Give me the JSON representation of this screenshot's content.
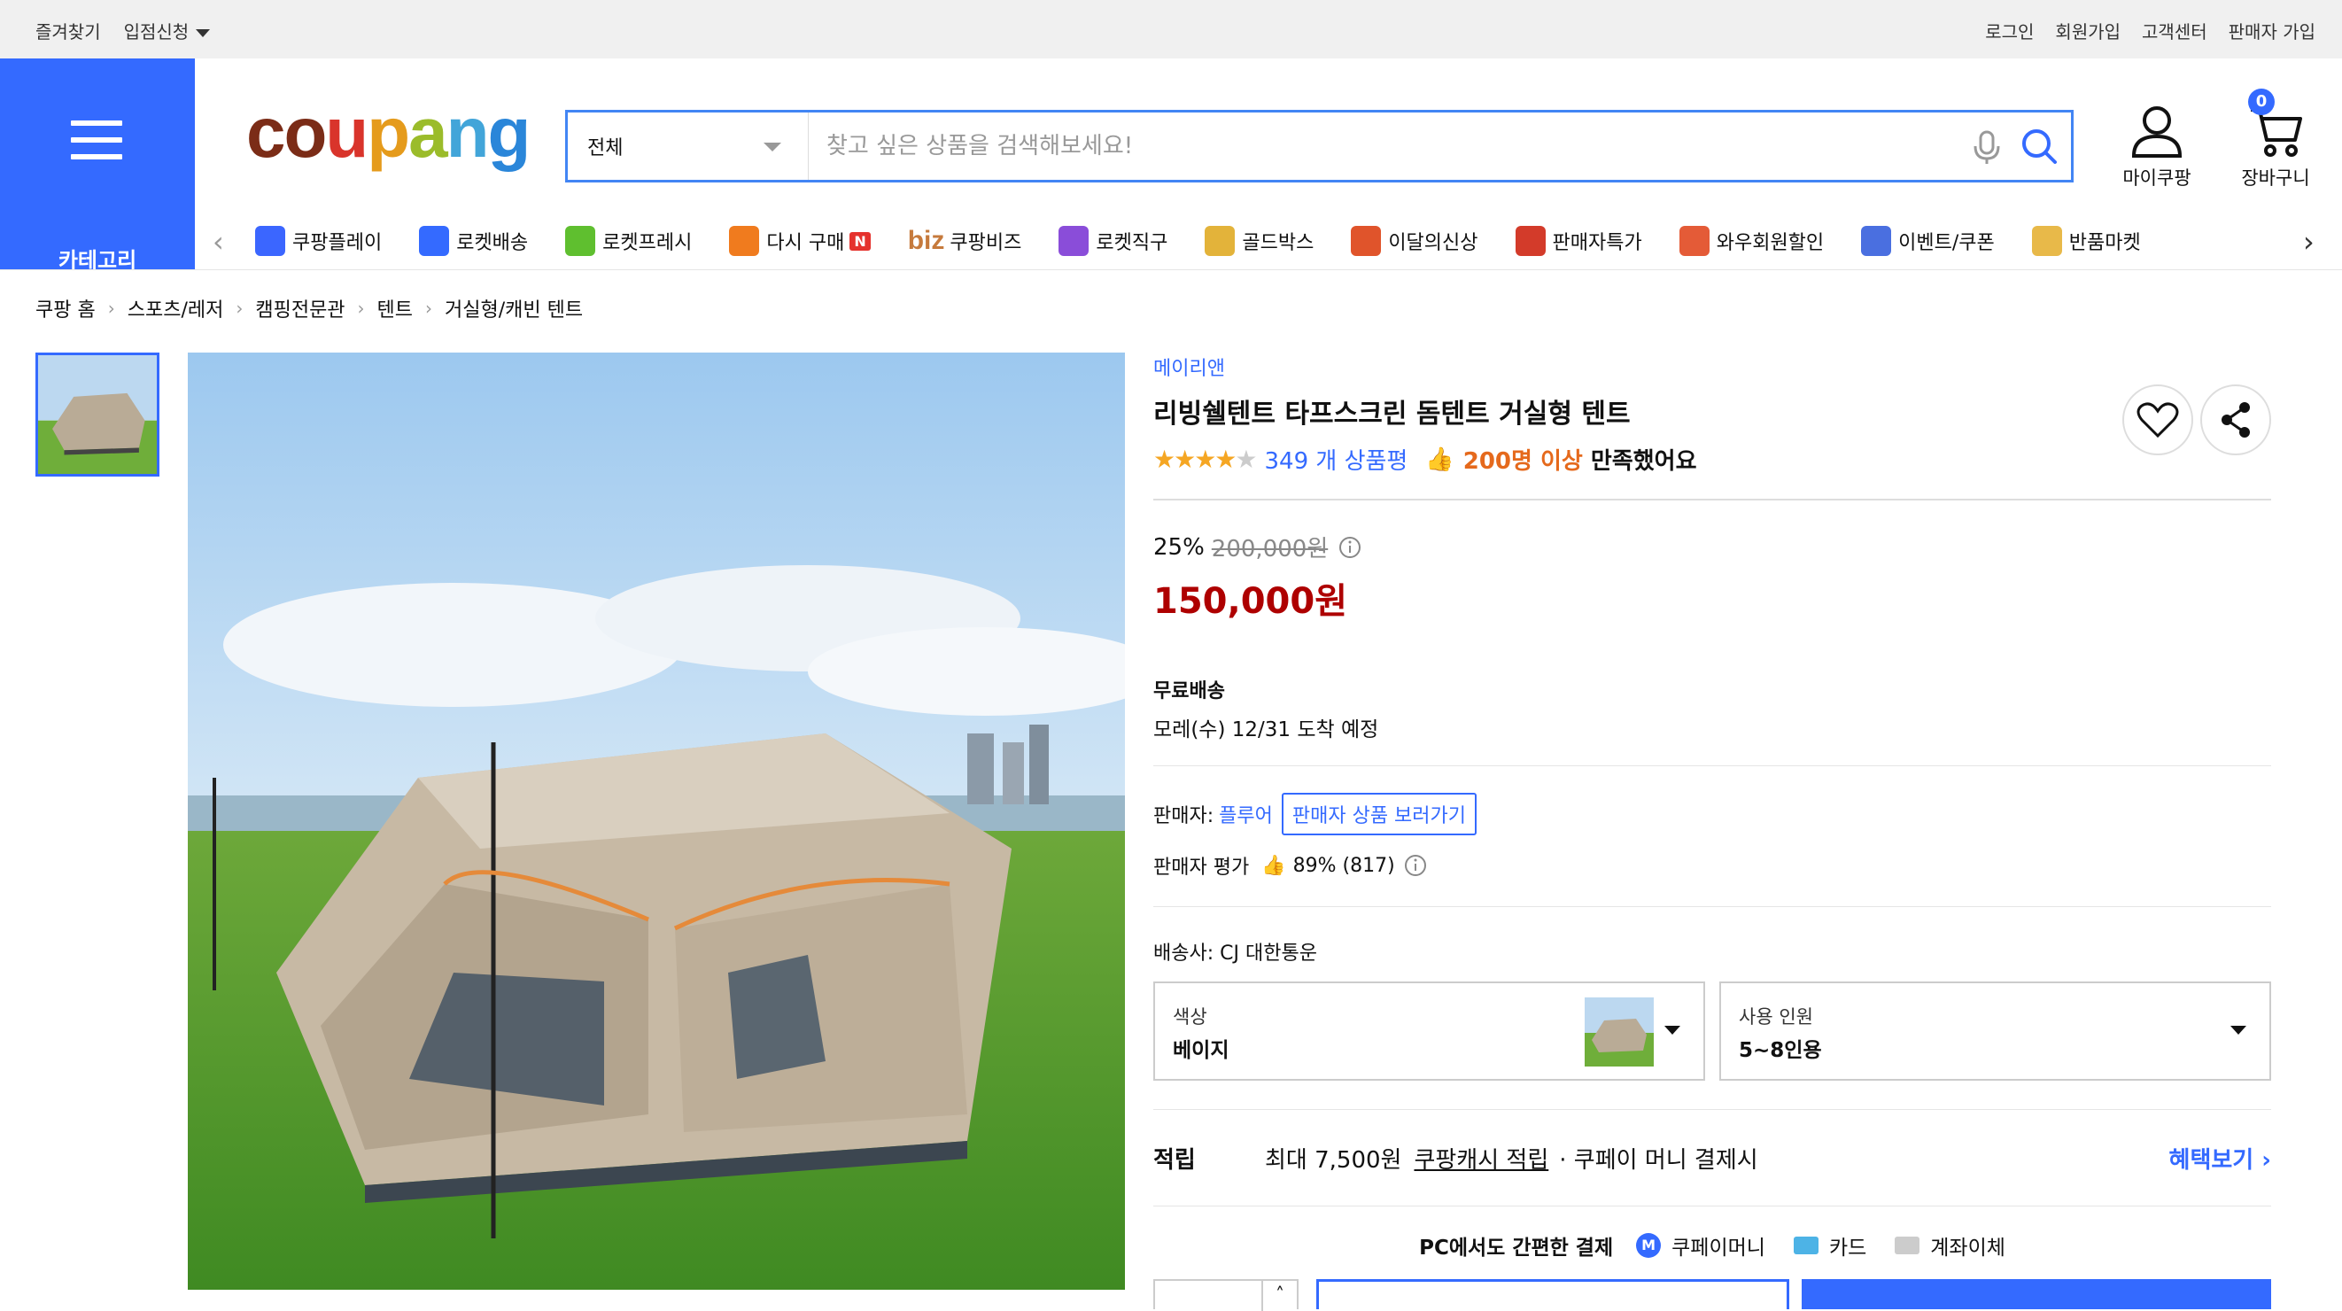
{
  "topbar": {
    "bookmark": "즐겨찾기",
    "signup_store": "입점신청",
    "login": "로그인",
    "join": "회원가입",
    "cs": "고객센터",
    "seller_join": "판매자 가입"
  },
  "header": {
    "category_label": "카테고리",
    "logo": {
      "c": "c",
      "o": "o",
      "u": "u",
      "p": "p",
      "a": "a",
      "n": "n",
      "g": "g"
    },
    "search_category": "전체",
    "search_placeholder": "찾고 싶은 상품을 검색해보세요!",
    "mycoupang": "마이쿠팡",
    "cart": "장바구니",
    "cart_count": "0"
  },
  "nav": [
    {
      "label": "쿠팡플레이",
      "icon": "play-icon",
      "color": "#3b66ff"
    },
    {
      "label": "로켓배송",
      "icon": "rocket-icon",
      "color": "#346aff"
    },
    {
      "label": "로켓프레시",
      "icon": "rocket-fresh-icon",
      "color": "#5fbf2f"
    },
    {
      "label": "다시 구매",
      "icon": "basket-icon",
      "color": "#f07b1e",
      "badge": "N"
    },
    {
      "label": "쿠팡비즈",
      "icon": "biz-icon",
      "color": "#c67a3c",
      "prefix": "biz"
    },
    {
      "label": "로켓직구",
      "icon": "global-rocket-icon",
      "color": "#8a4dd9"
    },
    {
      "label": "골드박스",
      "icon": "goldbox-icon",
      "color": "#e3b33a"
    },
    {
      "label": "이달의신상",
      "icon": "new-bag-icon",
      "color": "#e0542b"
    },
    {
      "label": "판매자특가",
      "icon": "percent-badge-icon",
      "color": "#d33b2a"
    },
    {
      "label": "와우회원할인",
      "icon": "wow-icon",
      "color": "#e45b37"
    },
    {
      "label": "이벤트/쿠폰",
      "icon": "coupon-icon",
      "color": "#4a6fe0"
    },
    {
      "label": "반품마켓",
      "icon": "sale-market-icon",
      "color": "#e8b949"
    }
  ],
  "breadcrumb": [
    "쿠팡 홈",
    "스포츠/레저",
    "캠핑전문관",
    "텐트",
    "거실형/캐빈 텐트"
  ],
  "product": {
    "brand": "메이리앤",
    "title": "리빙쉘텐트 타프스크린 돔텐트 거실형 텐트",
    "rating": 4.5,
    "review_count": "349 개 상품평",
    "satisfaction_hi": "200명 이상",
    "satisfaction_rest": "만족했어요",
    "discount": "25%",
    "original_price": "200,000원",
    "price": "150,000원",
    "shipping_title": "무료배송",
    "shipping_date": "모레(수) 12/31 도착 예정",
    "seller_label": "판매자:",
    "seller_name": "플루어",
    "seller_products": "판매자 상품 보러가기",
    "seller_rating_label": "판매자 평가",
    "seller_rating": "89% (817)",
    "carrier": "배송사:  CJ 대한통운",
    "option1_label": "색상",
    "option1_value": "베이지",
    "option2_label": "사용 인원",
    "option2_value": "5~8인용",
    "reward_label": "적립",
    "reward_max": "최대 7,500원",
    "reward_cash": "쿠팡캐시 적립",
    "reward_cond": "· 쿠페이 머니 결제시",
    "reward_more": "혜택보기",
    "pay_title": "PC에서도 간편한 결제",
    "pay_money": "쿠페이머니",
    "pay_card": "카드",
    "pay_bank": "계좌이체"
  },
  "colors": {
    "accent": "#346aff",
    "price": "#ae0000",
    "star": "#f5a623"
  }
}
